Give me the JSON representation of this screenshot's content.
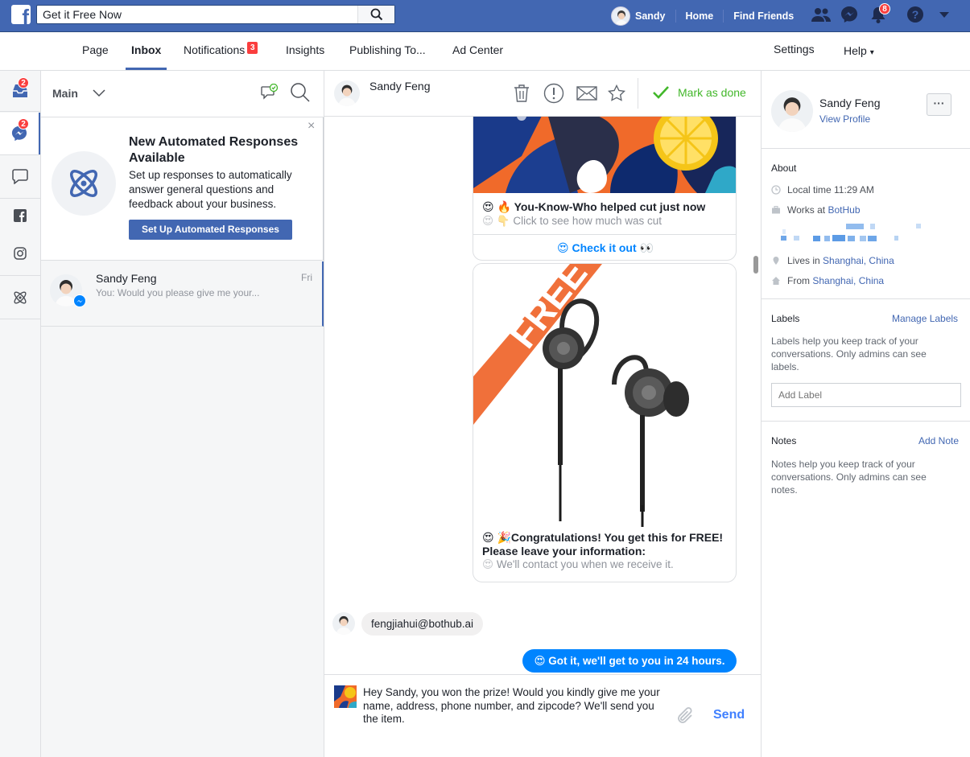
{
  "topbar": {
    "logo": "f",
    "search_value": "Get it Free Now",
    "user_name": "Sandy",
    "nav_home": "Home",
    "nav_find_friends": "Find Friends",
    "notif_count": "8"
  },
  "page_tabs": {
    "page": "Page",
    "inbox": "Inbox",
    "notifications": "Notifications",
    "notifications_badge": "3",
    "insights": "Insights",
    "publishing": "Publishing To...",
    "ad_center": "Ad Center",
    "settings": "Settings",
    "help": "Help",
    "help_caret": "▾"
  },
  "rail": {
    "inbox_badge": "2",
    "messenger_badge": "2"
  },
  "convlist": {
    "filter": "Main",
    "promo_title": "New Automated Responses Available",
    "promo_body": "Set up responses to automatically answer general questions and feedback about your business.",
    "promo_cta": "Set Up Automated Responses",
    "close": "×",
    "rows": [
      {
        "name": "Sandy Feng",
        "preview": "You: Would you please give me your...",
        "time": "Fri"
      }
    ]
  },
  "chat": {
    "contact": "Sandy Feng",
    "mark_done": "Mark as done",
    "card1": {
      "title": "You-Know-Who helped cut just now",
      "title_emoji": "😍 🔥",
      "subtitle": "Click to see how much was cut",
      "subtitle_emoji": "😍 👇",
      "button": "Check it out",
      "button_emoji_left": "😍",
      "button_emoji_right": "👀"
    },
    "card2": {
      "ribbon": "FREE",
      "title": "Congratulations! You get this for FREE! Please leave your information:",
      "title_emoji": "😍 🎉",
      "subtitle": "We'll contact you when we receive it.",
      "subtitle_emoji": "😍"
    },
    "incoming_message": "fengjiahui@bothub.ai",
    "outgoing_message": "Got it, we'll get to you in 24 hours.",
    "outgoing_emoji": "😍",
    "compose_text": "Hey Sandy, you won the prize! Would you kindly give me your name, address, phone number, and zipcode? We'll send you the item.",
    "send": "Send"
  },
  "right_panel": {
    "name": "Sandy Feng",
    "view_profile": "View Profile",
    "more": "···",
    "about": "About",
    "local_time": "Local time 11:29 AM",
    "works_at_prefix": "Works at",
    "works_at": "BotHub",
    "lives_in_prefix": "Lives in",
    "lives_in": "Shanghai, China",
    "from_prefix": "From",
    "from": "Shanghai, China",
    "labels_title": "Labels",
    "manage_labels": "Manage Labels",
    "labels_help": "Labels help you keep track of your conversations. Only admins can see labels.",
    "add_label_placeholder": "Add Label",
    "notes_title": "Notes",
    "add_note": "Add Note",
    "notes_help": "Notes help you keep track of your conversations. Only admins can see notes."
  },
  "colors": {
    "fb_blue": "#4267b2",
    "badge_red": "#fa3e3e",
    "done_green": "#42b72a",
    "messenger_blue": "#0084ff"
  },
  "icons": [
    "search-icon",
    "friends-icon",
    "messenger-icon",
    "bell-icon",
    "help-icon",
    "caret-down-icon",
    "inbox-icon",
    "comment-icon",
    "facebook-icon",
    "instagram-icon",
    "atom-icon",
    "trash-icon",
    "spam-icon",
    "envelope-icon",
    "star-icon",
    "check-icon",
    "paperclip-icon",
    "clock-icon",
    "briefcase-icon",
    "pin-icon",
    "home-icon"
  ]
}
